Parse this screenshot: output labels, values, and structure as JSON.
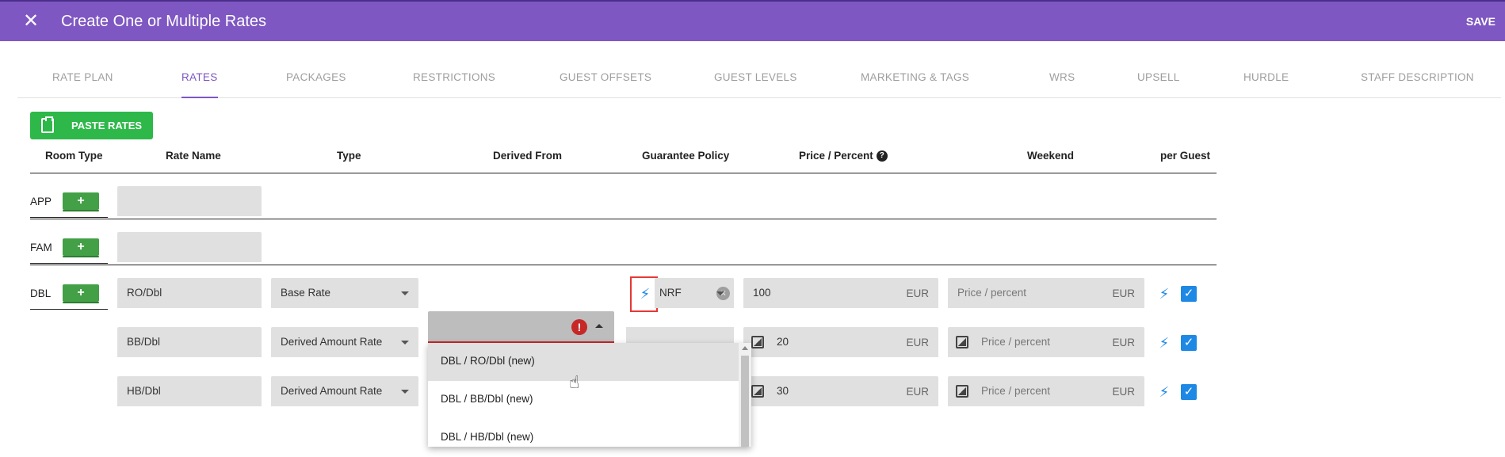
{
  "header": {
    "title": "Create One or Multiple Rates",
    "save_label": "SAVE",
    "close_label": "✕"
  },
  "tabs": [
    {
      "label": "RATE PLAN"
    },
    {
      "label": "RATES"
    },
    {
      "label": "PACKAGES"
    },
    {
      "label": "RESTRICTIONS"
    },
    {
      "label": "GUEST OFFSETS"
    },
    {
      "label": "GUEST LEVELS"
    },
    {
      "label": "MARKETING & TAGS"
    },
    {
      "label": "WRS"
    },
    {
      "label": "UPSELL"
    },
    {
      "label": "HURDLE"
    },
    {
      "label": "STAFF DESCRIPTION"
    }
  ],
  "active_tab": "RATES",
  "toolbar": {
    "paste_label": "PASTE RATES"
  },
  "columns": {
    "room_type": "Room Type",
    "rate_name": "Rate Name",
    "type": "Type",
    "derived_from": "Derived From",
    "guarantee_policy": "Guarantee Policy",
    "price_percent": "Price / Percent",
    "weekend": "Weekend",
    "per_guest": "per Guest"
  },
  "help_glyph": "?",
  "plus_glyph": "+",
  "rooms": [
    {
      "code": "APP"
    },
    {
      "code": "FAM"
    },
    {
      "code": "DBL"
    }
  ],
  "rates": [
    {
      "name": "RO/Dbl",
      "type": "Base Rate",
      "guarantee": "NRF",
      "price": "100",
      "currency": "EUR",
      "weekend_placeholder": "Price / percent",
      "weekend_currency": "EUR",
      "per_guest": true
    },
    {
      "name": "BB/Dbl",
      "type": "Derived Amount Rate",
      "price": "20",
      "currency": "EUR",
      "weekend_placeholder": "Price / percent",
      "weekend_currency": "EUR",
      "per_guest": true
    },
    {
      "name": "HB/Dbl",
      "type": "Derived Amount Rate",
      "price": "30",
      "currency": "EUR",
      "weekend_placeholder": "Price / percent",
      "weekend_currency": "EUR",
      "per_guest": true
    }
  ],
  "derived_dropdown": {
    "error_glyph": "!",
    "options": [
      "DBL / RO/Dbl (new)",
      "DBL / BB/Dbl (new)",
      "DBL / HB/Dbl (new)"
    ]
  },
  "colors": {
    "brand": "#7e57c2",
    "success": "#2eb84a",
    "accent_blue": "#1e88e5",
    "error": "#c62828"
  },
  "icons": {
    "bolt": "lightning-icon",
    "clear": "clear-icon",
    "checkbox": "checkbox-checked-icon"
  }
}
